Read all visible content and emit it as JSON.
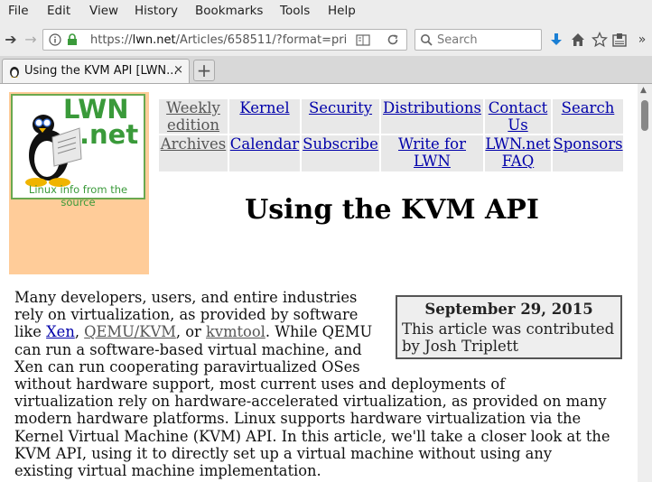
{
  "menu": [
    "File",
    "Edit",
    "View",
    "History",
    "Bookmarks",
    "Tools",
    "Help"
  ],
  "toolbar": {
    "url_prefix": "https://",
    "url_host": "lwn.net",
    "url_path": "/Articles/658511/?format=pri",
    "search_placeholder": "Search"
  },
  "tab": {
    "title": "Using the KVM API [LWN...",
    "close": "×"
  },
  "logo": {
    "line1": "LWN",
    "line2": ".net",
    "tagline": "Linux info from the source"
  },
  "nav": {
    "weekly": [
      "Weekly",
      "edition"
    ],
    "kernel": "Kernel",
    "security": "Security",
    "distributions": "Distributions",
    "contact": [
      "Contact",
      "Us"
    ],
    "search": "Search",
    "archives": "Archives",
    "calendar": "Calendar",
    "subscribe": "Subscribe",
    "write": [
      "Write for",
      "LWN"
    ],
    "faq": [
      "LWN.net",
      "FAQ"
    ],
    "sponsors": "Sponsors"
  },
  "article": {
    "title": "Using the KVM API",
    "date": "September 29, 2015",
    "contrib": [
      "This article was contributed",
      "by Josh Triplett"
    ],
    "l1": "Many developers, users, and entire industries",
    "l2": "rely on virtualization, as provided by software",
    "l3a": "like ",
    "xen": "Xen",
    "c1": ", ",
    "qemu": "QEMU/KVM",
    "c2": ", or ",
    "kvmtool": "kvmtool",
    "l3b": ". While QEMU",
    "l4": "can run a software-based virtual machine, and",
    "l5": "Xen can run cooperating paravirtualized OSes",
    "l6": "without hardware support, most current uses and deployments of",
    "l7": "virtualization rely on hardware-accelerated virtualization, as provided on many",
    "l8": "modern hardware platforms. Linux supports hardware virtualization via the",
    "l9": "Kernel Virtual Machine (KVM) API. In this article, we'll take a closer look at the",
    "l10": "KVM API, using it to directly set up a virtual machine without using any",
    "l11": "existing virtual machine implementation."
  }
}
